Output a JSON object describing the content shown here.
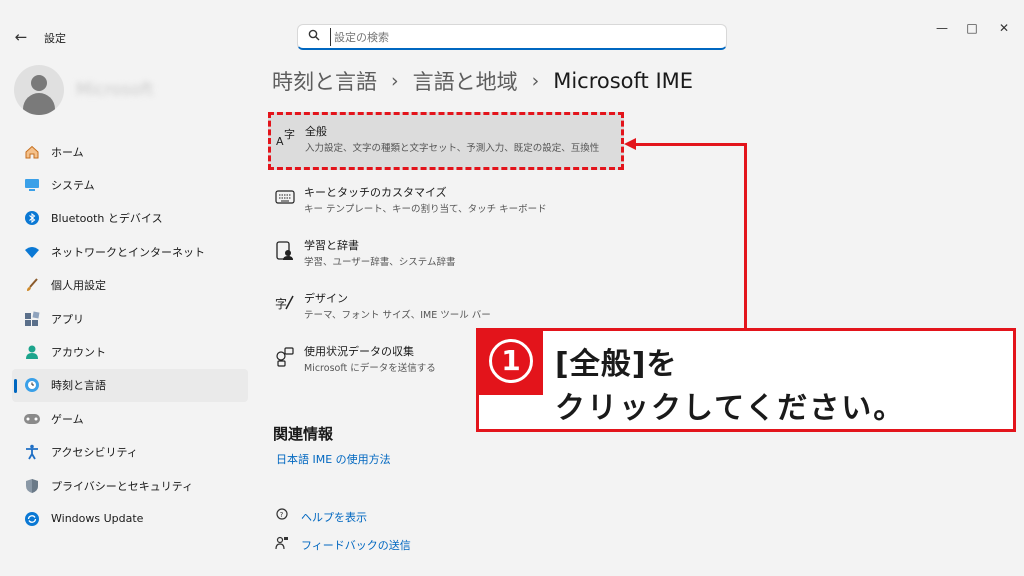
{
  "window": {
    "back_icon": "arrow-left-icon",
    "title": "設定",
    "minimize_icon": "minimize-icon",
    "maximize_icon": "maximize-icon",
    "close_icon": "close-icon"
  },
  "search": {
    "placeholder": "設定の検索",
    "icon": "search-icon"
  },
  "profile": {
    "name": "Microsoft"
  },
  "sidebar": {
    "items": [
      {
        "label": "ホーム",
        "icon": "home-icon",
        "color": "#e58a30"
      },
      {
        "label": "システム",
        "icon": "monitor-icon",
        "color": "#0a78d4"
      },
      {
        "label": "Bluetooth とデバイス",
        "icon": "bluetooth-icon",
        "color": "#0a78d4"
      },
      {
        "label": "ネットワークとインターネット",
        "icon": "wifi-icon",
        "color": "#0a78d4"
      },
      {
        "label": "個人用設定",
        "icon": "brush-icon",
        "color": "#d08a2a"
      },
      {
        "label": "アプリ",
        "icon": "apps-icon",
        "color": "#5a6f8a"
      },
      {
        "label": "アカウント",
        "icon": "account-icon",
        "color": "#1ca48c"
      },
      {
        "label": "時刻と言語",
        "icon": "globe-clock-icon",
        "color": "#0a78d4",
        "active": true
      },
      {
        "label": "ゲーム",
        "icon": "gamepad-icon",
        "color": "#7a7a7a"
      },
      {
        "label": "アクセシビリティ",
        "icon": "accessibility-icon",
        "color": "#1f6fc5"
      },
      {
        "label": "プライバシーとセキュリティ",
        "icon": "shield-icon",
        "color": "#6b7a88"
      },
      {
        "label": "Windows Update",
        "icon": "update-icon",
        "color": "#0a78d4"
      }
    ]
  },
  "breadcrumb": {
    "part1": "時刻と言語",
    "part2": "言語と地域",
    "current": "Microsoft IME",
    "separator": "›"
  },
  "settings": [
    {
      "title": "全般",
      "desc": "入力設定、文字の種類と文字セット、予測入力、既定の設定、互換性",
      "icon": "ime-general-icon"
    },
    {
      "title": "キーとタッチのカスタマイズ",
      "desc": "キー テンプレート、キーの割り当て、タッチ キーボード",
      "icon": "keyboard-icon"
    },
    {
      "title": "学習と辞書",
      "desc": "学習、ユーザー辞書、システム辞書",
      "icon": "dictionary-icon"
    },
    {
      "title": "デザイン",
      "desc": "テーマ、フォント サイズ、IME ツール バー",
      "icon": "design-icon"
    },
    {
      "title": "使用状況データの収集",
      "desc": "Microsoft にデータを送信する",
      "icon": "data-collection-icon"
    }
  ],
  "related": {
    "title": "関連情報",
    "link": "日本語 IME の使用方法"
  },
  "footer_links": [
    {
      "label": "ヘルプを表示",
      "icon": "help-icon"
    },
    {
      "label": "フィードバックの送信",
      "icon": "feedback-icon"
    }
  ],
  "annotation": {
    "number": "①",
    "line1": "[全般]を",
    "line2": "クリックしてください。",
    "color": "#e3141b"
  }
}
